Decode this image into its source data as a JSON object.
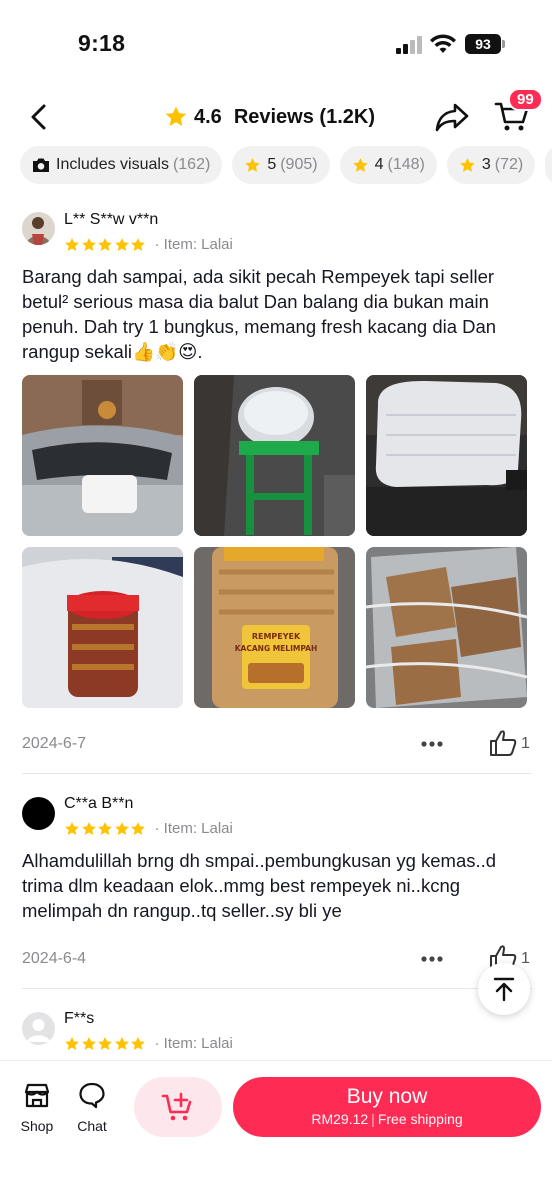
{
  "status": {
    "time": "9:18",
    "battery": "93"
  },
  "header": {
    "rating": "4.6",
    "title": "Reviews (1.2K)",
    "cart_badge": "99",
    "icons": [
      "back-arrow-icon",
      "star-icon",
      "share-icon",
      "cart-icon"
    ]
  },
  "filters": [
    {
      "label": "Includes visuals",
      "count": "(162)",
      "icon": "camera-icon"
    },
    {
      "label": "5",
      "count": "(905)",
      "icon": "star-icon"
    },
    {
      "label": "4",
      "count": "(148)",
      "icon": "star-icon"
    },
    {
      "label": "3",
      "count": "(72)",
      "icon": "star-icon"
    }
  ],
  "reviews": [
    {
      "user": "L** S**w v**n",
      "stars": 5,
      "item": "· Item: Lalai",
      "text": "Barang dah sampai, ada sikit pecah Rempeyek tapi seller betul² serious masa dia balut Dan balang dia bukan main penuh. Dah try 1 bungkus, memang fresh kacang dia Dan rangup sekali👍👏😍.",
      "date": "2024-6-7",
      "likes": "1",
      "photo_count": 6,
      "photo_labels": [
        "REMPEYEK",
        "KACANG MELIMPAH"
      ]
    },
    {
      "user": "C**a B**n",
      "stars": 5,
      "item": "· Item: Lalai",
      "text": "Alhamdulillah brng dh smpai..pembungkusan yg kemas..d trima dlm keadaan elok..mmg best rempeyek ni..kcng melimpah dn rangup..tq seller..sy bli ye",
      "date": "2024-6-4",
      "likes": "1"
    },
    {
      "user": "F**s",
      "stars": 5,
      "item": "· Item: Lalai"
    }
  ],
  "bottom": {
    "shop_label": "Shop",
    "chat_label": "Chat",
    "buy_label": "Buy now",
    "price": "RM29.12",
    "shipping": "Free shipping"
  },
  "colors": {
    "accent": "#fe2c55",
    "star": "#fec300",
    "muted": "#8a8a8f"
  }
}
